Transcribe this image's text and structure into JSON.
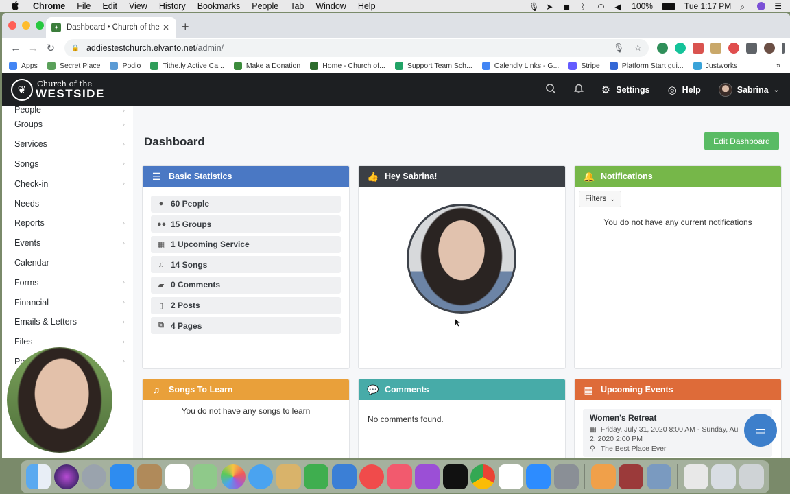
{
  "menubar": {
    "app": "Chrome",
    "items": [
      "File",
      "Edit",
      "View",
      "History",
      "Bookmarks",
      "People",
      "Tab",
      "Window",
      "Help"
    ],
    "battery": "100%",
    "clock": "Tue 1:17 PM"
  },
  "browser": {
    "tab_title": "Dashboard • Church of the We",
    "url_host": "addiestestchurch.elvanto.net",
    "url_path": "/admin/",
    "bookmarks": [
      {
        "label": "Apps",
        "color": "#4285f4"
      },
      {
        "label": "Secret Place",
        "color": "#5aa05a"
      },
      {
        "label": "Podio",
        "color": "#5b9bd5"
      },
      {
        "label": "Tithe.ly Active Ca...",
        "color": "#2f9e5a"
      },
      {
        "label": "Make a Donation",
        "color": "#3c8c3c"
      },
      {
        "label": "Home - Church of...",
        "color": "#2c6b2c"
      },
      {
        "label": "Support Team Sch...",
        "color": "#21a366"
      },
      {
        "label": "Calendly Links - G...",
        "color": "#4285f4"
      },
      {
        "label": "Stripe",
        "color": "#635bff"
      },
      {
        "label": "Platform Start gui...",
        "color": "#3367d6"
      },
      {
        "label": "Justworks",
        "color": "#39a3d9"
      }
    ]
  },
  "site": {
    "logo_small": "Church of the",
    "logo_big": "WESTSIDE",
    "settings_label": "Settings",
    "help_label": "Help",
    "user_name": "Sabrina"
  },
  "sidebar": {
    "items": [
      {
        "label": "People",
        "arrow": true
      },
      {
        "label": "Groups",
        "arrow": true
      },
      {
        "label": "Services",
        "arrow": true
      },
      {
        "label": "Songs",
        "arrow": true
      },
      {
        "label": "Check-in",
        "arrow": true
      },
      {
        "label": "Needs",
        "arrow": false
      },
      {
        "label": "Reports",
        "arrow": true
      },
      {
        "label": "Events",
        "arrow": true
      },
      {
        "label": "Calendar",
        "arrow": false
      },
      {
        "label": "Forms",
        "arrow": true
      },
      {
        "label": "Financial",
        "arrow": true
      },
      {
        "label": "Emails & Letters",
        "arrow": true
      },
      {
        "label": "Files",
        "arrow": true
      },
      {
        "label": "Po",
        "arrow": true
      }
    ]
  },
  "dashboard": {
    "title": "Dashboard",
    "edit_button": "Edit Dashboard",
    "basic_stats": {
      "title": "Basic Statistics",
      "rows": [
        {
          "icon": "person-icon",
          "label": "60 People"
        },
        {
          "icon": "group-icon",
          "label": "15 Groups"
        },
        {
          "icon": "calendar-icon",
          "label": "1 Upcoming Service"
        },
        {
          "icon": "music-icon",
          "label": "14 Songs"
        },
        {
          "icon": "comments-icon",
          "label": "0 Comments"
        },
        {
          "icon": "file-icon",
          "label": "2 Posts"
        },
        {
          "icon": "pages-icon",
          "label": "4 Pages"
        }
      ]
    },
    "greeting": {
      "title": "Hey Sabrina!"
    },
    "notifications": {
      "title": "Notifications",
      "filters": "Filters",
      "empty": "You do not have any current notifications"
    },
    "songs_to_learn": {
      "title": "Songs To Learn",
      "empty": "You do not have any songs to learn"
    },
    "comments": {
      "title": "Comments",
      "empty": "No comments found."
    },
    "upcoming_events": {
      "title": "Upcoming Events",
      "event_title": "Women's Retreat",
      "event_date_1": "Friday, July 31, 2020 8:00 AM - Sunday, Au",
      "event_date_2": "2, 2020 2:00 PM",
      "event_location": "The Best Place Ever"
    }
  },
  "colors": {
    "stats_header": "#4a78c4",
    "greeting_header": "#3b3f45",
    "notifications_header": "#76b749",
    "songs_header": "#e9a03a",
    "comments_header": "#47aba8",
    "events_header": "#de6b39",
    "edit_button": "#59bb64"
  }
}
